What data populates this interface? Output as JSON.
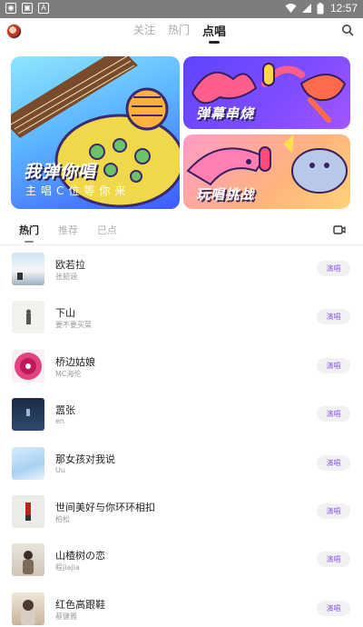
{
  "status_bar": {
    "time": "12:57",
    "icons": [
      "android-icon",
      "notification-icon",
      "text-icon"
    ]
  },
  "header": {
    "tabs": [
      {
        "label": "关注",
        "active": false
      },
      {
        "label": "热门",
        "active": false
      },
      {
        "label": "点唱",
        "active": true
      }
    ]
  },
  "banners": {
    "main": {
      "title": "我弹你唱",
      "subtitle": "主唱C位等你来"
    },
    "top_right": {
      "title": "弹幕串烧"
    },
    "bottom_right": {
      "title": "玩唱挑战"
    }
  },
  "sub_tabs": [
    {
      "label": "热门",
      "active": true
    },
    {
      "label": "推荐",
      "active": false
    },
    {
      "label": "已点",
      "active": false
    }
  ],
  "sing_label": "演唱",
  "songs": [
    {
      "title": "欧若拉",
      "artist": "张韶涵"
    },
    {
      "title": "下山",
      "artist": "要不要买菜"
    },
    {
      "title": "桥边姑娘",
      "artist": "MC海伦"
    },
    {
      "title": "嚣张",
      "artist": "en"
    },
    {
      "title": "那女孩对我说",
      "artist": "Uu"
    },
    {
      "title": "世间美好与你环环相扣",
      "artist": "柏松"
    },
    {
      "title": "山楂树の恋",
      "artist": "程jiajia"
    },
    {
      "title": "红色高跟鞋",
      "artist": "蔡健雅"
    }
  ],
  "colors": {
    "accent": "#8e5cf0",
    "status_bar": "#7d7d7d"
  }
}
